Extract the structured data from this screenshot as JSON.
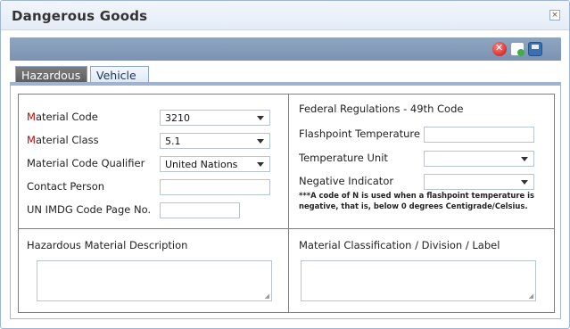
{
  "window": {
    "title": "Dangerous Goods",
    "close_symbol": "×"
  },
  "toolbar": {
    "cancel_icon": "cancel-icon",
    "new_icon": "new-document-icon",
    "save_icon": "save-icon"
  },
  "tabs": [
    {
      "label": "Hazardous",
      "active": true
    },
    {
      "label": "Vehicle",
      "active": false
    }
  ],
  "left": {
    "material_code": {
      "req_prefix": "M",
      "label_rest": "aterial Code",
      "value": "3210"
    },
    "material_class": {
      "req_prefix": "M",
      "label_rest": "aterial Class",
      "value": "5.1"
    },
    "qualifier": {
      "label": "Material Code Qualifier",
      "value": "United Nations"
    },
    "contact_person": {
      "label": "Contact Person",
      "value": ""
    },
    "imdg_page": {
      "label": "UN IMDG Code Page No.",
      "value": ""
    }
  },
  "right": {
    "section_title": "Federal Regulations - 49th Code",
    "flashpoint": {
      "label": "Flashpoint Temperature",
      "value": ""
    },
    "temp_unit": {
      "label": "Temperature Unit",
      "value": ""
    },
    "negative": {
      "label": "Negative Indicator",
      "value": ""
    },
    "note": "***A code of N is used when a flashpoint temperature is negative, that is, below 0 degrees Centigrade/Celsius."
  },
  "bottom": {
    "hazardous_desc_label": "Hazardous Material Description",
    "classification_label": "Material Classification / Division / Label"
  }
}
